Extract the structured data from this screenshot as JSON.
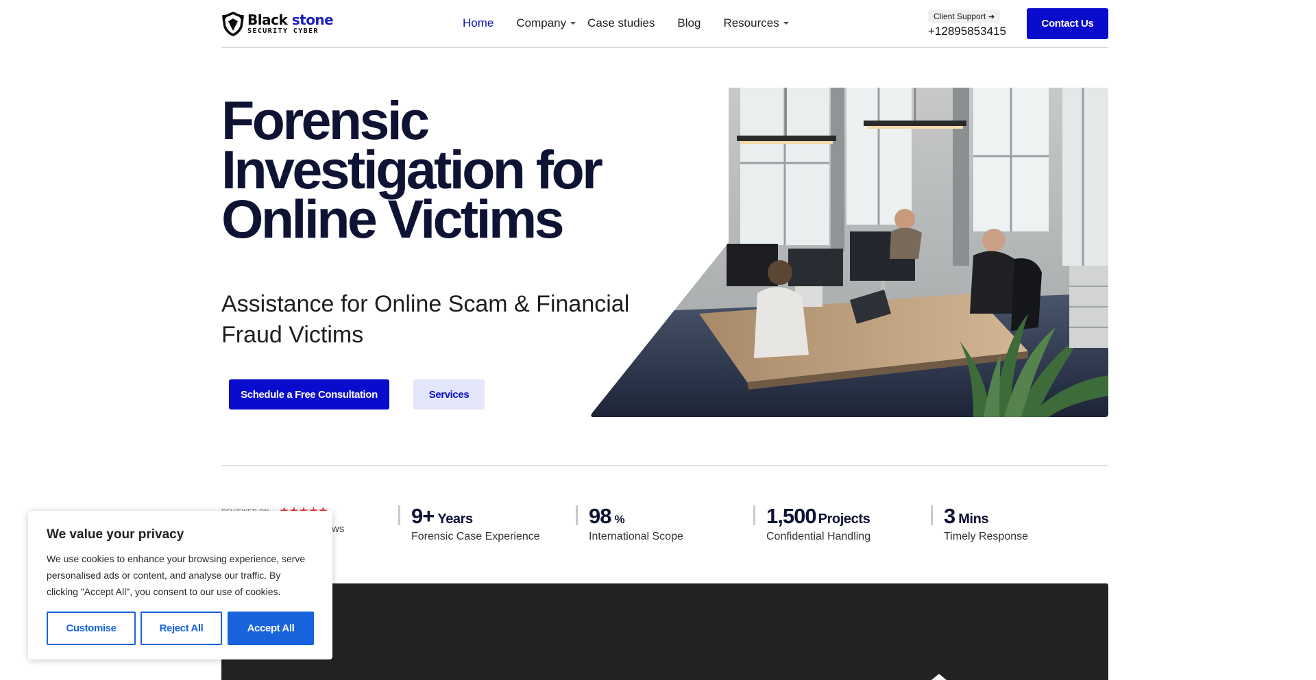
{
  "brand": {
    "name_part1": "Black",
    "name_part2": " stone",
    "tagline": "SECURITY CYBER"
  },
  "nav": {
    "items": [
      {
        "label": "Home",
        "active": true,
        "dropdown": false
      },
      {
        "label": "Company",
        "active": false,
        "dropdown": true
      },
      {
        "label": "Case studies",
        "active": false,
        "dropdown": false
      },
      {
        "label": "Blog",
        "active": false,
        "dropdown": false
      },
      {
        "label": "Resources",
        "active": false,
        "dropdown": true
      }
    ]
  },
  "support": {
    "label": "Client Support",
    "arrow": "➔",
    "phone": "+12895853415"
  },
  "header": {
    "contact_label": "Contact Us"
  },
  "hero": {
    "title_line1": "Forensic",
    "title_line2": "Investigation for",
    "title_line3": "Online Victims",
    "subtitle_line1": "Assistance for Online Scam & Financial",
    "subtitle_line2": "Fraud Victims",
    "primary_cta": "Schedule a Free Consultation",
    "secondary_cta": "Services",
    "image_icon": "office-photo"
  },
  "review": {
    "label": "REVIEWED ON",
    "stars": "★★★★★",
    "rating": 5,
    "count_text": "ws"
  },
  "stats": [
    {
      "number": "9+",
      "unit": "Years",
      "label": "Forensic Case Experience"
    },
    {
      "number": "98",
      "unit": "%",
      "label": "International Scope"
    },
    {
      "number": "1,500",
      "unit": "Projects",
      "label": "Confidential Handling"
    },
    {
      "number": "3",
      "unit": "Mins",
      "label": "Timely Response"
    }
  ],
  "cookie": {
    "title": "We value your privacy",
    "text": "We use cookies to enhance your browsing experience, serve personalised ads or content, and analyse our traffic. By clicking \"Accept All\", you consent to our use of cookies.",
    "customise": "Customise",
    "reject": "Reject All",
    "accept": "Accept All"
  },
  "colors": {
    "brand_blue": "#0a0ccd",
    "heading_navy": "#0f1333",
    "cookie_blue": "#1863dc",
    "star_red": "#e83b3b",
    "dark_section": "#232325"
  }
}
